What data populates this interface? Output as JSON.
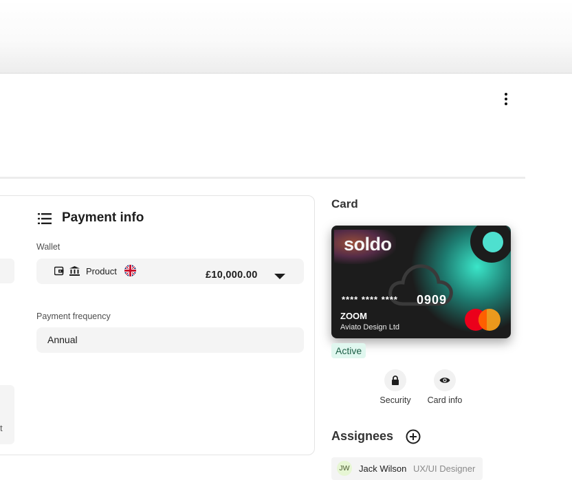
{
  "header": {
    "menu_icon": "more-vertical-icon"
  },
  "payment_info": {
    "title": "Payment info",
    "icon": "list-icon",
    "wallet": {
      "label": "Wallet",
      "icons": [
        "wallet-icon",
        "bank-icon"
      ],
      "name": "Product",
      "flag": "uk-flag-icon",
      "amount": "£10,000.00"
    },
    "payment_frequency": {
      "label": "Payment frequency",
      "value": "Annual"
    },
    "left_stub_text": "t"
  },
  "card": {
    "heading": "Card",
    "brand": "soldo",
    "number_mask": "**** **** ****",
    "number_last": "0909",
    "name": "ZOOM",
    "company": "Aviato Design Ltd",
    "network_icon": "mastercard-icon",
    "status": "Active",
    "actions": [
      {
        "label": "Security",
        "icon": "lock-icon"
      },
      {
        "label": "Card info",
        "icon": "eye-icon"
      }
    ]
  },
  "assignees": {
    "title": "Assignees",
    "add_icon": "plus-circle-icon",
    "items": [
      {
        "initials": "JW",
        "name": "Jack Wilson",
        "role": "UX/UI Designer"
      }
    ]
  },
  "colors": {
    "accent_teal": "#4ee0cf",
    "badge_bg": "#e0f7ef",
    "field_bg": "#f4f4f4"
  }
}
